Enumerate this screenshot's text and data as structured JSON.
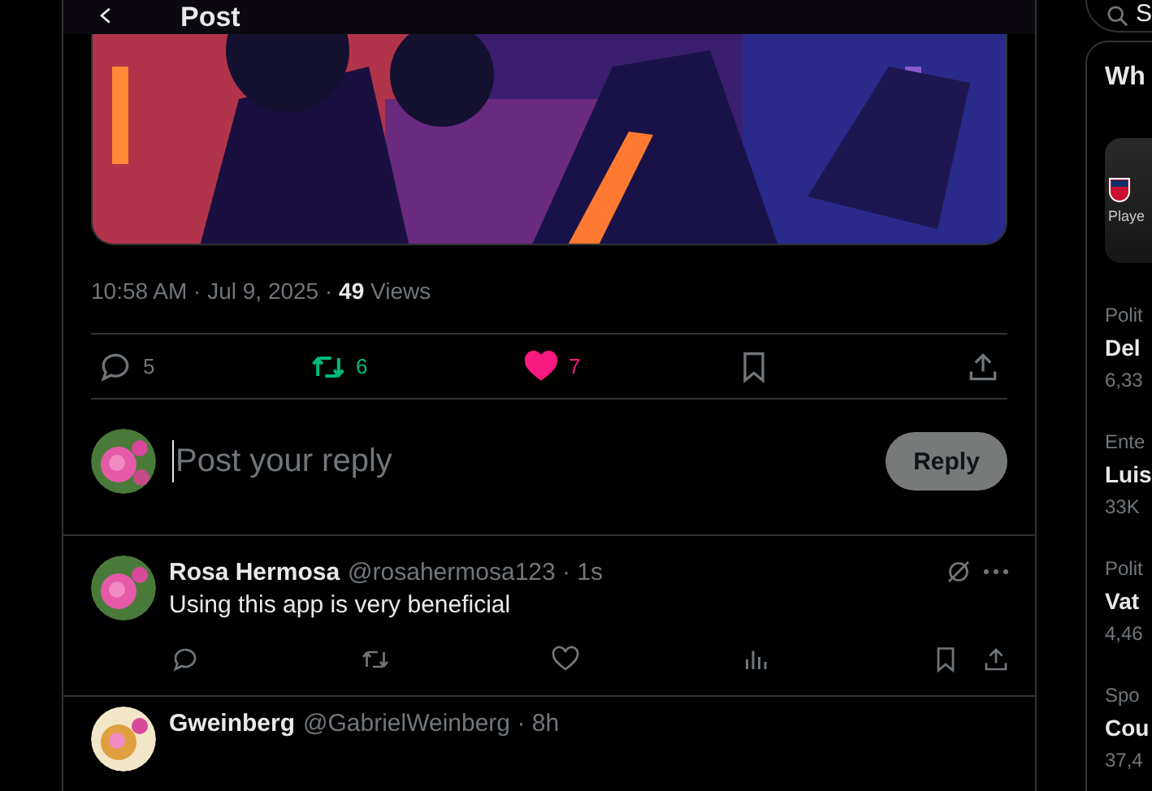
{
  "header": {
    "title": "Post"
  },
  "post": {
    "meta": "10:58 AM · Jul 9, 2025 · **49** Views",
    "actions": [
      {
        "kind": "reply",
        "count": "5",
        "active": false
      },
      {
        "kind": "repost",
        "count": "6",
        "active": true
      },
      {
        "kind": "like",
        "count": "7",
        "active": true
      },
      {
        "kind": "bookmark",
        "active": false
      },
      {
        "kind": "share"
      }
    ]
  },
  "composer": {
    "placeholder": "Post your reply",
    "button": "Reply",
    "button_disabled": true
  },
  "replies": [
    {
      "name": "Rosa Hermosa",
      "handle": "@rosahermosa123 · 1s",
      "text": "Using this app is very beneficial",
      "actions": [
        {
          "kind": "reply"
        },
        {
          "kind": "repost"
        },
        {
          "kind": "like"
        },
        {
          "kind": "views"
        },
        {
          "kind": "bookmark"
        },
        {
          "kind": "share"
        }
      ]
    },
    {
      "name": "Gweinberg",
      "handle": "@GabrielWeinberg · 8h"
    }
  ],
  "sidebar": {
    "search_text": "S",
    "title": "Wh",
    "featured": {
      "label": "Playe"
    },
    "trends": [
      {
        "category": "Polit",
        "name": "Del",
        "count": "6,33"
      },
      {
        "category": "Ente",
        "name": "Luis",
        "count": "33K"
      },
      {
        "category": "Polit",
        "name": "Vat",
        "count": "4,46"
      },
      {
        "category": "Spo",
        "name": "Cou",
        "count": "37,4"
      }
    ]
  }
}
